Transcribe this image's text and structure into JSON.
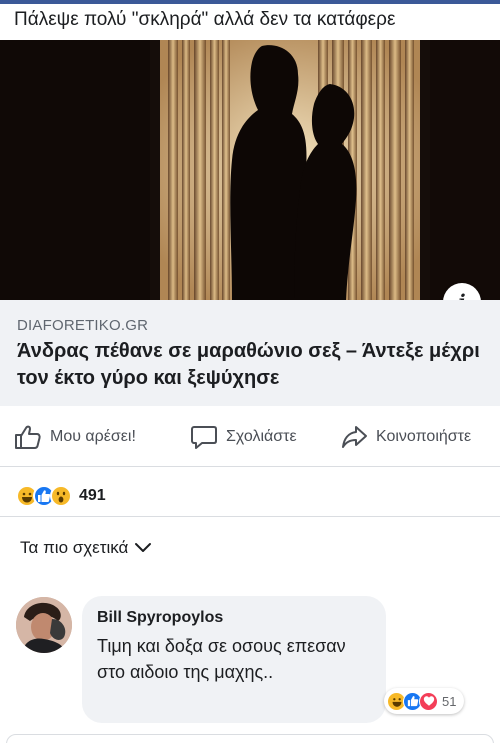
{
  "post": {
    "caption": "Πάλεψε πολύ \"σκληρά\" αλλά δεν τα κατάφερε"
  },
  "link": {
    "domain": "DIAFORETIKO.GR",
    "title": "Άνδρας πέθανε σε μαραθώνιο σεξ – Άντεξε μέχρι τον έκτο γύρο και ξεψύχησε",
    "info_icon": "i"
  },
  "actions": {
    "like_label": "Μου αρέσει!",
    "comment_label": "Σχολιάστε",
    "share_label": "Κοινοποιήστε"
  },
  "reactions": {
    "icons": [
      "haha-icon",
      "like-icon",
      "wow-icon"
    ],
    "count": "491"
  },
  "comments_sort": {
    "label": "Τα πιο σχετικά"
  },
  "comment": {
    "author": "Bill Spyropoylos",
    "text": "Τιμη και δοξα σε οσους επεσαν στο αιδοιο της μαχης..",
    "reactions": [
      "haha-icon",
      "like-icon",
      "love-icon"
    ],
    "reaction_count": "51"
  },
  "colors": {
    "brand": "#3b5998",
    "like_blue": "#1877f2",
    "love_red": "#f33e58",
    "emoji_yellow": "#f7b928"
  }
}
